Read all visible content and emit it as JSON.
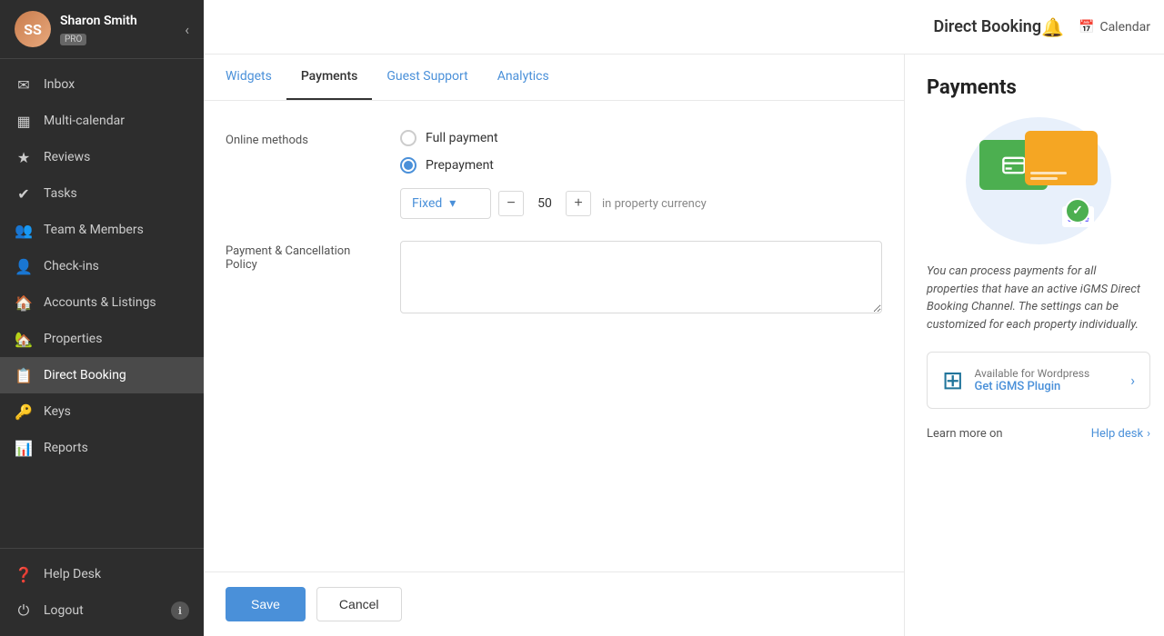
{
  "sidebar": {
    "user": {
      "name": "Sharon Smith",
      "badge": "PRO",
      "initials": "SS"
    },
    "nav_items": [
      {
        "id": "inbox",
        "label": "Inbox",
        "icon": "✉"
      },
      {
        "id": "multi-calendar",
        "label": "Multi-calendar",
        "icon": "▦"
      },
      {
        "id": "reviews",
        "label": "Reviews",
        "icon": "★"
      },
      {
        "id": "tasks",
        "label": "Tasks",
        "icon": "✔"
      },
      {
        "id": "team-members",
        "label": "Team & Members",
        "icon": "👥"
      },
      {
        "id": "check-ins",
        "label": "Check-ins",
        "icon": "👤"
      },
      {
        "id": "accounts-listings",
        "label": "Accounts & Listings",
        "icon": "🏠"
      },
      {
        "id": "properties",
        "label": "Properties",
        "icon": "🏡"
      },
      {
        "id": "direct-booking",
        "label": "Direct Booking",
        "icon": "📋"
      },
      {
        "id": "keys",
        "label": "Keys",
        "icon": "🔑"
      },
      {
        "id": "reports",
        "label": "Reports",
        "icon": "📊"
      }
    ],
    "footer_items": [
      {
        "id": "help-desk",
        "label": "Help Desk",
        "icon": "❓"
      },
      {
        "id": "logout",
        "label": "Logout",
        "icon": "⏻"
      }
    ]
  },
  "header": {
    "title": "Direct Booking",
    "calendar_label": "Calendar",
    "notification_icon": "🔔"
  },
  "tabs": [
    {
      "id": "widgets",
      "label": "Widgets",
      "active": false
    },
    {
      "id": "payments",
      "label": "Payments",
      "active": true
    },
    {
      "id": "guest-support",
      "label": "Guest Support",
      "active": false
    },
    {
      "id": "analytics",
      "label": "Analytics",
      "active": false
    }
  ],
  "form": {
    "online_methods_label": "Online methods",
    "payment_policy_label": "Payment & Cancellation Policy",
    "full_payment_label": "Full payment",
    "prepayment_label": "Prepayment",
    "selected_method": "prepayment",
    "dropdown_value": "Fixed",
    "amount_value": "50",
    "currency_note": "in property currency",
    "save_label": "Save",
    "cancel_label": "Cancel"
  },
  "right_panel": {
    "title": "Payments",
    "description": "You can process payments for all properties that have an active iGMS Direct Booking Channel. The settings can be customized for each property individually.",
    "wordpress": {
      "available_label": "Available for Wordpress",
      "link_label": "Get iGMS Plugin"
    },
    "helpdesk": {
      "prefix": "Learn more on",
      "link_label": "Help desk"
    }
  }
}
